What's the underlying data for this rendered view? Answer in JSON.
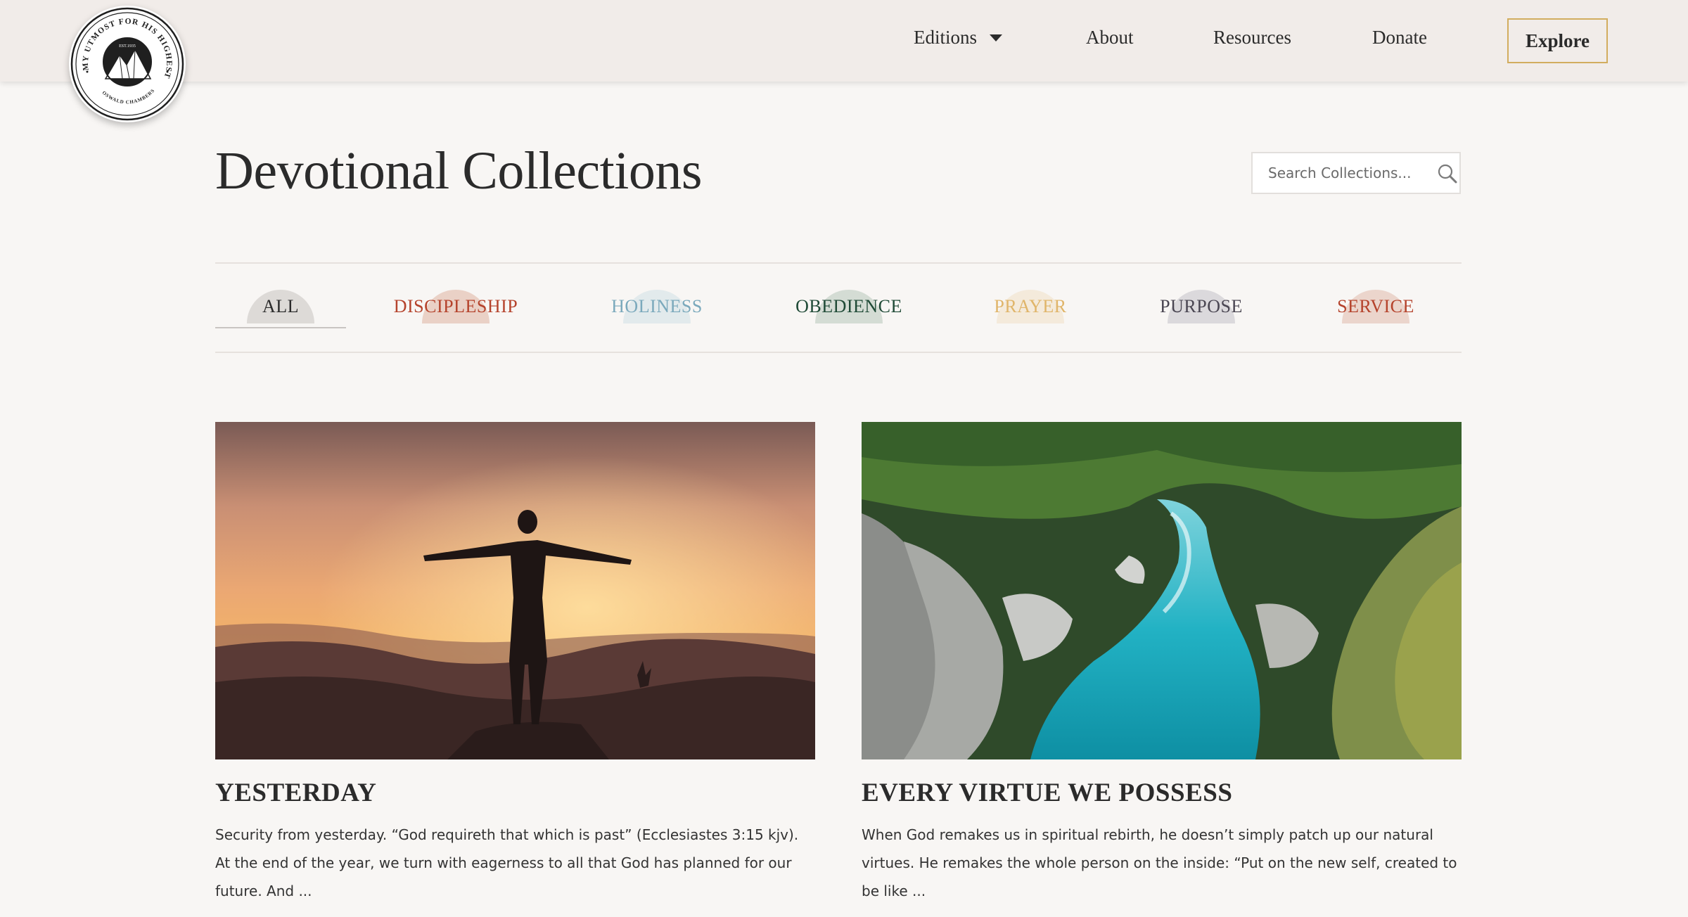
{
  "logo": {
    "arc_text": "MY UTMOST FOR HIS HIGHEST",
    "est_text": "EST.1935",
    "bottom_text": "OSWALD CHAMBERS",
    "icon": "mountain-emblem"
  },
  "nav": {
    "editions": "Editions",
    "about": "About",
    "resources": "Resources",
    "donate": "Donate",
    "explore": "Explore"
  },
  "page": {
    "title": "Devotional Collections"
  },
  "search": {
    "placeholder": "Search Collections...",
    "icon": "search-icon"
  },
  "filters": [
    {
      "label": "ALL",
      "color": "#2b2b2b",
      "dome": "#bdb8b4",
      "active": true
    },
    {
      "label": "DISCIPLESHIP",
      "color": "#b5432c",
      "dome": "#d9a38d"
    },
    {
      "label": "HOLINESS",
      "color": "#7ba9bc",
      "dome": "#c8dbe2"
    },
    {
      "label": "OBEDIENCE",
      "color": "#1f4a36",
      "dome": "#a8bcae"
    },
    {
      "label": "PRAYER",
      "color": "#e0b56a",
      "dome": "#efdcbc"
    },
    {
      "label": "PURPOSE",
      "color": "#4a4652",
      "dome": "#b9b6be"
    },
    {
      "label": "SERVICE",
      "color": "#b5432c",
      "dome": "#dcae9c"
    }
  ],
  "cards": [
    {
      "title": "YESTERDAY",
      "excerpt": "Security from yesterday. “God requireth that which is past” (Ecclesiastes 3:15 kjv). At the end of the year, we turn with eagerness to all that God has planned for our future. And ...",
      "image": "man-silhouette-sunset"
    },
    {
      "title": "EVERY VIRTUE WE POSSESS",
      "excerpt": "When God remakes us in spiritual rebirth, he doesn’t simply patch up our natural virtues. He remakes the whole person on the inside: “Put on the new self, created to be like ...",
      "image": "turquoise-river-gorge"
    }
  ],
  "colors": {
    "background": "#f8f6f4",
    "header": "#f1ece9",
    "accent_gold": "#d2ad5f",
    "text": "#2b2b2b"
  }
}
